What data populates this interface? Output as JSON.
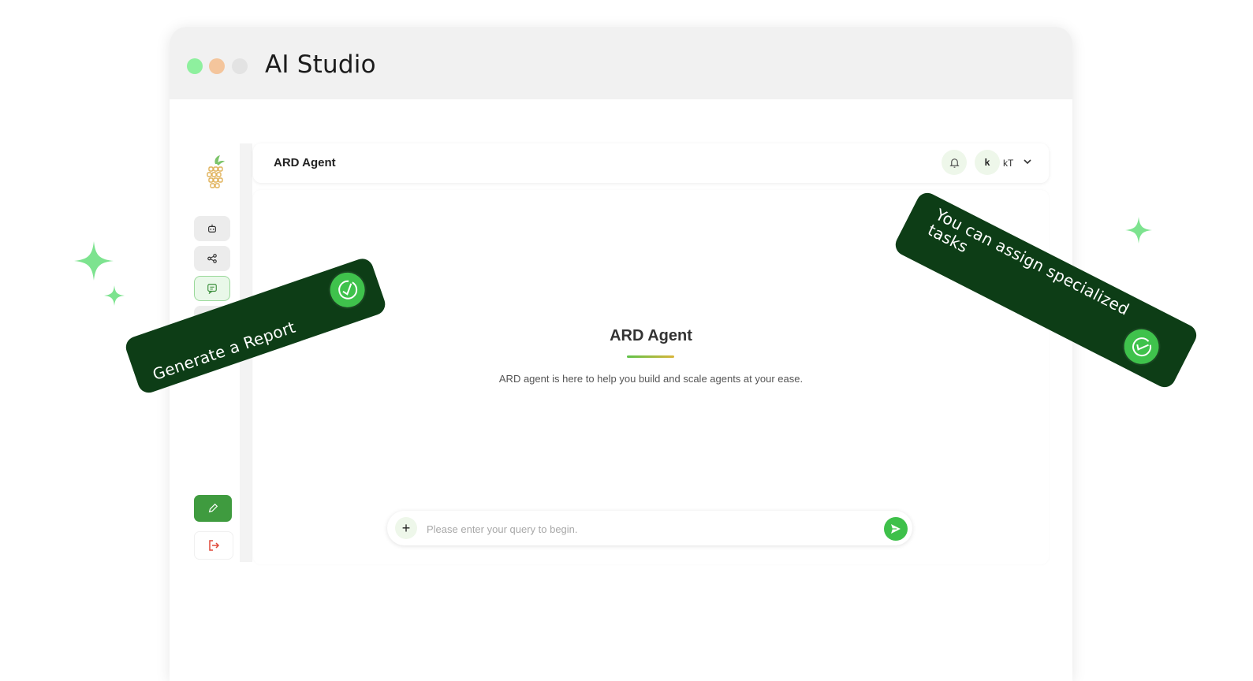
{
  "window": {
    "title": "AI Studio",
    "controls": [
      "close",
      "minimize",
      "maximize"
    ]
  },
  "sidebar": {
    "logo": "pineapple-logo",
    "items": [
      {
        "icon": "robot-icon",
        "active": false
      },
      {
        "icon": "workflow-icon",
        "active": false
      },
      {
        "icon": "chat-icon",
        "active": true
      },
      {
        "icon": "bar-chart-icon",
        "active": false
      }
    ],
    "bottom": [
      {
        "icon": "pencil-icon"
      },
      {
        "icon": "logout-icon"
      }
    ]
  },
  "header": {
    "title": "ARD Agent",
    "bell_icon": "bell-icon",
    "avatar_initial": "k",
    "user_name": "kT",
    "chevron_icon": "chevron-down-icon"
  },
  "main": {
    "heading": "ARD Agent",
    "description": "ARD agent is here to help you build and scale agents at your ease."
  },
  "query": {
    "placeholder": "Please enter your query to begin.",
    "value": "",
    "add_label": "+"
  },
  "ribbons": {
    "left": "Generate a Report",
    "right": "You can assign specialized tasks"
  },
  "colors": {
    "accent": "#3fc24c",
    "ribbon": "#0d3d16",
    "edit_button": "#3f9b3f",
    "sparkle": "#7de38f"
  }
}
